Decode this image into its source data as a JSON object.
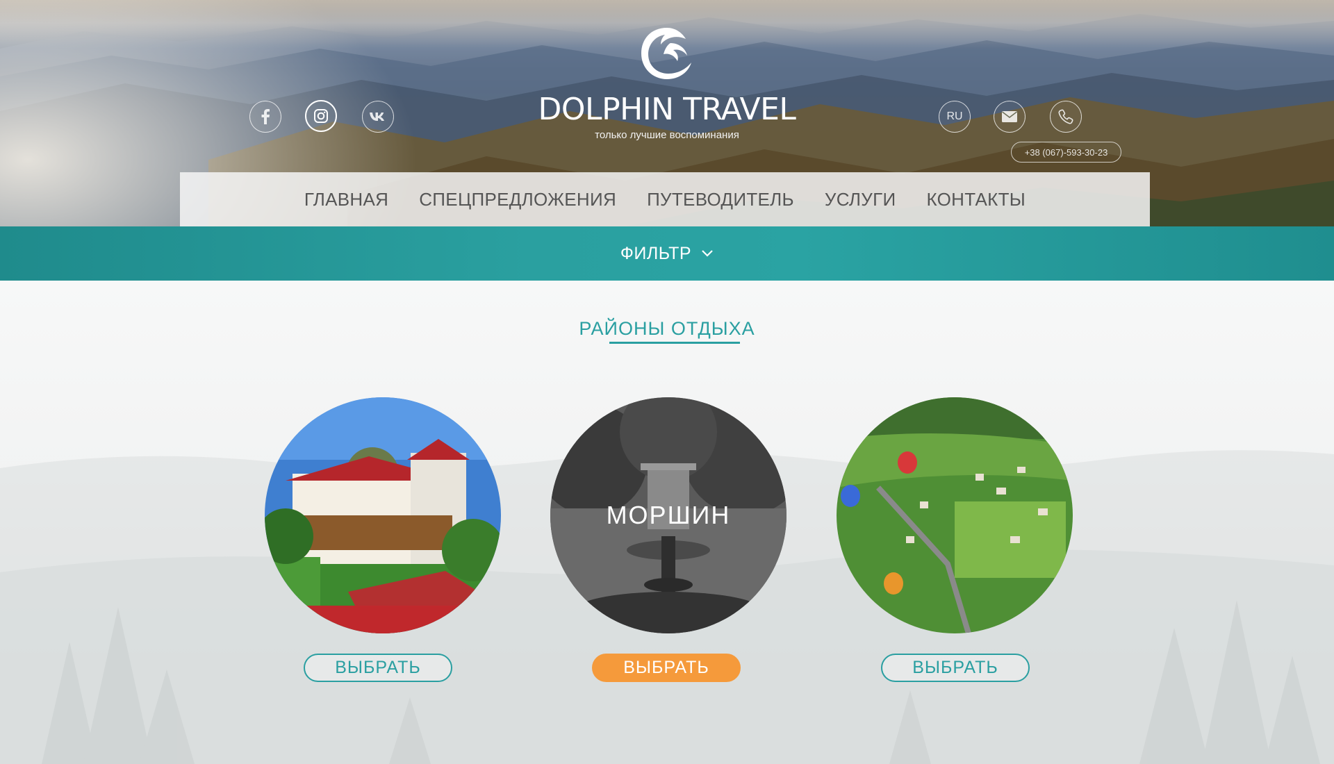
{
  "brand": {
    "name": "DOLPHIN TRAVEL",
    "tagline": "только лучшие воспоминания",
    "logo_icon": "dolphin-logo-icon"
  },
  "header": {
    "social": [
      {
        "icon": "facebook-icon",
        "glyph": "f"
      },
      {
        "icon": "instagram-icon",
        "glyph": ""
      },
      {
        "icon": "vk-icon",
        "glyph": "vk"
      }
    ],
    "language": "RU",
    "mail_icon": "mail-icon",
    "phone_icon": "phone-icon",
    "phone": "+38 (067)-593-30-23"
  },
  "nav": {
    "items": [
      "ГЛАВНАЯ",
      "СПЕЦПРЕДЛОЖЕНИЯ",
      "ПУТЕВОДИТЕЛЬ",
      "УСЛУГИ",
      "КОНТАКТЫ"
    ]
  },
  "filter": {
    "label": "ФИЛЬТР",
    "icon": "chevron-down-icon"
  },
  "main": {
    "section_title": "РАЙОНЫ ОТДЫХА",
    "regions": [
      {
        "name": "",
        "button": "ВЫБРАТЬ"
      },
      {
        "name": "МОРШИН",
        "button": "ВЫБРАТЬ"
      },
      {
        "name": "",
        "button": "ВЫБРАТЬ"
      }
    ]
  },
  "colors": {
    "accent": "#2a9fa1",
    "highlight": "#f59a3b",
    "nav_bg": "#f5f5f5"
  }
}
